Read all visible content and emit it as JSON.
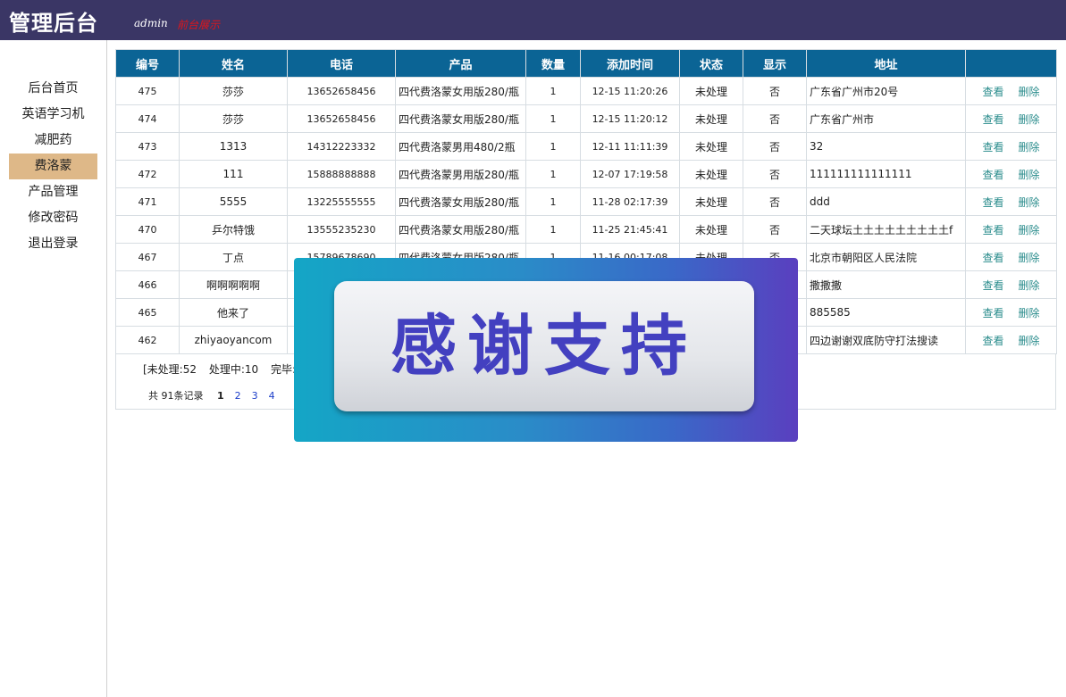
{
  "app": {
    "title": "管理后台",
    "user": "admin",
    "demo_link": "前台展示"
  },
  "sidebar": {
    "items": [
      {
        "label": "后台首页",
        "active": false
      },
      {
        "label": "英语学习机",
        "active": false
      },
      {
        "label": "减肥药",
        "active": false
      },
      {
        "label": "费洛蒙",
        "active": true
      },
      {
        "label": "产品管理",
        "active": false
      },
      {
        "label": "修改密码",
        "active": false
      },
      {
        "label": "退出登录",
        "active": false
      }
    ]
  },
  "table": {
    "headers": [
      "编号",
      "姓名",
      "电话",
      "产品",
      "数量",
      "添加时间",
      "状态",
      "显示",
      "地址",
      ""
    ],
    "actions": {
      "view": "查看",
      "delete": "删除"
    },
    "rows": [
      {
        "id": "475",
        "name": "莎莎",
        "phone": "13652658456",
        "product": "四代费洛蒙女用版280/瓶",
        "qty": "1",
        "time": "12-15 11:20:26",
        "status": "未处理",
        "show": "否",
        "address": "广东省广州市20号"
      },
      {
        "id": "474",
        "name": "莎莎",
        "phone": "13652658456",
        "product": "四代费洛蒙女用版280/瓶",
        "qty": "1",
        "time": "12-15 11:20:12",
        "status": "未处理",
        "show": "否",
        "address": "广东省广州市"
      },
      {
        "id": "473",
        "name": "1313",
        "phone": "14312223332",
        "product": "四代费洛蒙男用480/2瓶",
        "qty": "1",
        "time": "12-11 11:11:39",
        "status": "未处理",
        "show": "否",
        "address": "32"
      },
      {
        "id": "472",
        "name": "111",
        "phone": "15888888888",
        "product": "四代费洛蒙男用版280/瓶",
        "qty": "1",
        "time": "12-07 17:19:58",
        "status": "未处理",
        "show": "否",
        "address": "111111111111111"
      },
      {
        "id": "471",
        "name": "5555",
        "phone": "13225555555",
        "product": "四代费洛蒙女用版280/瓶",
        "qty": "1",
        "time": "11-28 02:17:39",
        "status": "未处理",
        "show": "否",
        "address": "ddd"
      },
      {
        "id": "470",
        "name": "乒尔特饿",
        "phone": "13555235230",
        "product": "四代费洛蒙女用版280/瓶",
        "qty": "1",
        "time": "11-25 21:45:41",
        "status": "未处理",
        "show": "否",
        "address": "二天球坛土土土土土土土土土f"
      },
      {
        "id": "467",
        "name": "丁点",
        "phone": "15789678690",
        "product": "四代费洛蒙女用版280/瓶",
        "qty": "1",
        "time": "11-16 00:17:08",
        "status": "未处理",
        "show": "否",
        "address": "北京市朝阳区人民法院"
      },
      {
        "id": "466",
        "name": "啊啊啊啊啊",
        "phone": "",
        "product": "",
        "qty": "",
        "time": "",
        "status": "",
        "show": "",
        "address": "撒撒撒"
      },
      {
        "id": "465",
        "name": "他来了",
        "phone": "",
        "product": "",
        "qty": "",
        "time": "",
        "status": "",
        "show": "",
        "address": "885585"
      },
      {
        "id": "462",
        "name": "zhiyaoyancom",
        "phone": "",
        "product": "",
        "qty": "",
        "time": "",
        "status": "",
        "show": "",
        "address": "四边谢谢双底防守打法搜读"
      }
    ]
  },
  "summary": {
    "pending": "[未处理:52",
    "processing": "处理中:10",
    "done": "完毕:3"
  },
  "pager": {
    "total": "共 91条记录",
    "pages": [
      "1",
      "2",
      "3",
      "4"
    ],
    "current": "1"
  },
  "overlay": {
    "text": "感谢支持"
  }
}
